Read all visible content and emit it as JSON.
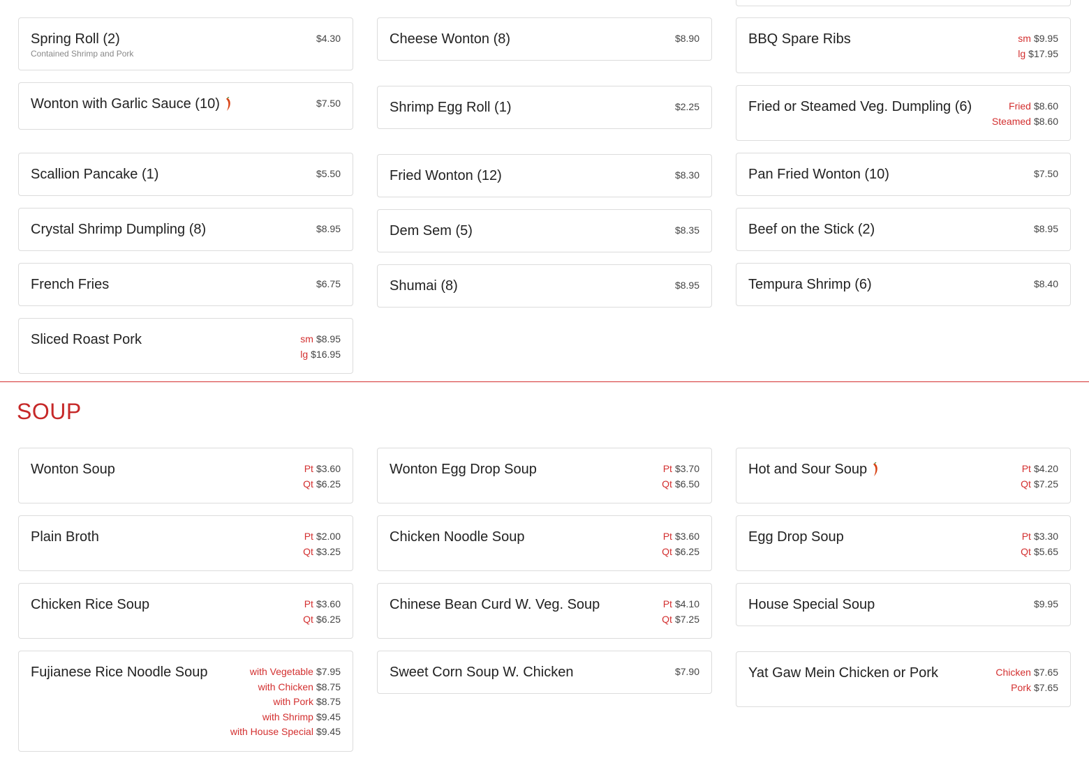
{
  "appetizers": {
    "columns": [
      [
        {
          "name": "Spring Roll (2)",
          "desc": "Contained Shrimp and Pork",
          "spicy": false,
          "prices": [
            {
              "label": "",
              "price": "$4.30"
            }
          ],
          "mb": 17
        },
        {
          "name": "Wonton with Garlic Sauce (10)",
          "desc": "",
          "spicy": true,
          "prices": [
            {
              "label": "",
              "price": "$7.50"
            }
          ],
          "mb": 33
        },
        {
          "name": "Scallion Pancake (1)",
          "desc": "",
          "spicy": false,
          "prices": [
            {
              "label": "",
              "price": "$5.50"
            }
          ],
          "mb": 17
        },
        {
          "name": "Crystal Shrimp Dumpling (8)",
          "desc": "",
          "spicy": false,
          "prices": [
            {
              "label": "",
              "price": "$8.95"
            }
          ],
          "mb": 17
        },
        {
          "name": "French Fries",
          "desc": "",
          "spicy": false,
          "prices": [
            {
              "label": "",
              "price": "$6.75"
            }
          ],
          "mb": 17
        },
        {
          "name": "Sliced Roast Pork",
          "desc": "",
          "spicy": false,
          "prices": [
            {
              "label": "sm",
              "price": "$8.95"
            },
            {
              "label": "lg",
              "price": "$16.95"
            }
          ],
          "mb": 0
        }
      ],
      [
        {
          "name": "Cheese Wonton (8)",
          "desc": "",
          "spicy": false,
          "prices": [
            {
              "label": "",
              "price": "$8.90"
            }
          ],
          "mb": 36
        },
        {
          "name": "Shrimp Egg Roll (1)",
          "desc": "",
          "spicy": false,
          "prices": [
            {
              "label": "",
              "price": "$2.25"
            }
          ],
          "mb": 36
        },
        {
          "name": "Fried Wonton (12)",
          "desc": "",
          "spicy": false,
          "prices": [
            {
              "label": "",
              "price": "$8.30"
            }
          ],
          "mb": 17
        },
        {
          "name": "Dem Sem (5)",
          "desc": "",
          "spicy": false,
          "prices": [
            {
              "label": "",
              "price": "$8.35"
            }
          ],
          "mb": 17
        },
        {
          "name": "Shumai (8)",
          "desc": "",
          "spicy": false,
          "prices": [
            {
              "label": "",
              "price": "$8.95"
            }
          ],
          "mb": 0
        }
      ],
      [
        {
          "name": "BBQ Spare Ribs",
          "desc": "",
          "spicy": false,
          "prices": [
            {
              "label": "sm",
              "price": "$9.95"
            },
            {
              "label": "lg",
              "price": "$17.95"
            }
          ],
          "mb": 17
        },
        {
          "name": "Fried or Steamed Veg. Dumpling (6)",
          "desc": "",
          "spicy": false,
          "prices": [
            {
              "label": "Fried",
              "price": "$8.60"
            },
            {
              "label": "Steamed",
              "price": "$8.60"
            }
          ],
          "mb": 17
        },
        {
          "name": "Pan Fried Wonton (10)",
          "desc": "",
          "spicy": false,
          "prices": [
            {
              "label": "",
              "price": "$7.50"
            }
          ],
          "mb": 17
        },
        {
          "name": "Beef on the Stick (2)",
          "desc": "",
          "spicy": false,
          "prices": [
            {
              "label": "",
              "price": "$8.95"
            }
          ],
          "mb": 17
        },
        {
          "name": "Tempura Shrimp (6)",
          "desc": "",
          "spicy": false,
          "prices": [
            {
              "label": "",
              "price": "$8.40"
            }
          ],
          "mb": 0
        }
      ]
    ]
  },
  "soup_section": {
    "title": "SOUP",
    "columns": [
      [
        {
          "name": "Wonton Soup",
          "desc": "",
          "spicy": false,
          "prices": [
            {
              "label": "Pt",
              "price": "$3.60"
            },
            {
              "label": "Qt",
              "price": "$6.25"
            }
          ],
          "mb": 17
        },
        {
          "name": "Plain Broth",
          "desc": "",
          "spicy": false,
          "prices": [
            {
              "label": "Pt",
              "price": "$2.00"
            },
            {
              "label": "Qt",
              "price": "$3.25"
            }
          ],
          "mb": 17
        },
        {
          "name": "Chicken Rice Soup",
          "desc": "",
          "spicy": false,
          "prices": [
            {
              "label": "Pt",
              "price": "$3.60"
            },
            {
              "label": "Qt",
              "price": "$6.25"
            }
          ],
          "mb": 17
        },
        {
          "name": "Fujianese Rice Noodle Soup",
          "desc": "",
          "spicy": false,
          "prices": [
            {
              "label": "with Vegetable",
              "price": "$7.95"
            },
            {
              "label": "with Chicken",
              "price": "$8.75"
            },
            {
              "label": "with Pork",
              "price": "$8.75"
            },
            {
              "label": "with Shrimp",
              "price": "$9.45"
            },
            {
              "label": "with House Special",
              "price": "$9.45"
            }
          ],
          "mb": 0
        }
      ],
      [
        {
          "name": "Wonton Egg Drop Soup",
          "desc": "",
          "spicy": false,
          "prices": [
            {
              "label": "Pt",
              "price": "$3.70"
            },
            {
              "label": "Qt",
              "price": "$6.50"
            }
          ],
          "mb": 17
        },
        {
          "name": "Chicken Noodle Soup",
          "desc": "",
          "spicy": false,
          "prices": [
            {
              "label": "Pt",
              "price": "$3.60"
            },
            {
              "label": "Qt",
              "price": "$6.25"
            }
          ],
          "mb": 17
        },
        {
          "name": "Chinese Bean Curd W. Veg. Soup",
          "desc": "",
          "spicy": false,
          "prices": [
            {
              "label": "Pt",
              "price": "$4.10"
            },
            {
              "label": "Qt",
              "price": "$7.25"
            }
          ],
          "mb": 17
        },
        {
          "name": "Sweet Corn Soup W. Chicken",
          "desc": "",
          "spicy": false,
          "prices": [
            {
              "label": "",
              "price": "$7.90"
            }
          ],
          "mb": 0
        }
      ],
      [
        {
          "name": "Hot and Sour Soup",
          "desc": "",
          "spicy": true,
          "prices": [
            {
              "label": "Pt",
              "price": "$4.20"
            },
            {
              "label": "Qt",
              "price": "$7.25"
            }
          ],
          "mb": 17
        },
        {
          "name": "Egg Drop Soup",
          "desc": "",
          "spicy": false,
          "prices": [
            {
              "label": "Pt",
              "price": "$3.30"
            },
            {
              "label": "Qt",
              "price": "$5.65"
            }
          ],
          "mb": 17
        },
        {
          "name": "House Special Soup",
          "desc": "",
          "spicy": false,
          "prices": [
            {
              "label": "",
              "price": "$9.95"
            }
          ],
          "mb": 36
        },
        {
          "name": "Yat Gaw Mein Chicken or Pork",
          "desc": "",
          "spicy": false,
          "prices": [
            {
              "label": "Chicken",
              "price": "$7.65"
            },
            {
              "label": "Pork",
              "price": "$7.65"
            }
          ],
          "mb": 0
        }
      ]
    ]
  },
  "icons": {
    "spicy": "chili-pepper-icon"
  },
  "colors": {
    "accent": "#d32f2f",
    "title": "#c62828",
    "border": "#dcdcdc"
  }
}
